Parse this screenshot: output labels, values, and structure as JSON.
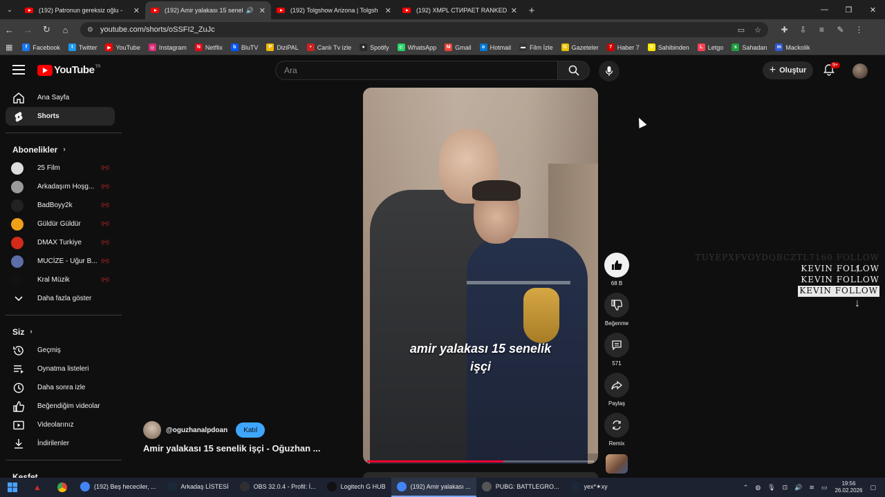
{
  "browser": {
    "tabs": [
      {
        "title": "(192) Patronun gereksiz oğlu -",
        "active": false
      },
      {
        "title": "(192) Amir yalakası 15 senel",
        "active": true,
        "audio": true
      },
      {
        "title": "(192) Tolgshow Arizona | Tolgsh",
        "active": false
      },
      {
        "title": "(192) XMPL СТИРАЕТ RANKED",
        "active": false
      }
    ],
    "url": "youtube.com/shorts/oSSFI2_ZuJc",
    "bookmarks": [
      {
        "label": "Facebook",
        "color": "#1877f2",
        "glyph": "f"
      },
      {
        "label": "Twitter",
        "color": "#1d9bf0",
        "glyph": "t"
      },
      {
        "label": "YouTube",
        "color": "#ff0000",
        "glyph": "▶"
      },
      {
        "label": "Instagram",
        "color": "#d62976",
        "glyph": "◎"
      },
      {
        "label": "Netflix",
        "color": "#e50914",
        "glyph": "N"
      },
      {
        "label": "BluTV",
        "color": "#0057ff",
        "glyph": "b"
      },
      {
        "label": "DiziPAL",
        "color": "#f2b705",
        "glyph": "P"
      },
      {
        "label": "Canlı Tv izle",
        "color": "#cc2222",
        "glyph": "•"
      },
      {
        "label": "Spotify",
        "color": "#2a2a2a",
        "glyph": "●"
      },
      {
        "label": "WhatsApp",
        "color": "#25d366",
        "glyph": "✆"
      },
      {
        "label": "Gmail",
        "color": "#ea4335",
        "glyph": "M"
      },
      {
        "label": "Hotmail",
        "color": "#0078d4",
        "glyph": "o"
      },
      {
        "label": "Film İzle",
        "color": "#333333",
        "glyph": "▬"
      },
      {
        "label": "Gazeteler",
        "color": "#e6c200",
        "glyph": "G"
      },
      {
        "label": "Haber 7",
        "color": "#d10000",
        "glyph": "7"
      },
      {
        "label": "Sahibinden",
        "color": "#ffe800",
        "glyph": "S"
      },
      {
        "label": "Letgo",
        "color": "#ff3f55",
        "glyph": "L"
      },
      {
        "label": "Sahadan",
        "color": "#1e9e3e",
        "glyph": "s"
      },
      {
        "label": "Mackolik",
        "color": "#2f5bd6",
        "glyph": "m"
      }
    ]
  },
  "youtube": {
    "logo_text": "YouTube",
    "region": "TR",
    "search_placeholder": "Ara",
    "create_label": "Oluştur",
    "notification_badge": "9+"
  },
  "sidebar": {
    "main": [
      {
        "label": "Ana Sayfa",
        "icon": "home-icon",
        "active": false
      },
      {
        "label": "Shorts",
        "icon": "shorts-icon",
        "active": true
      }
    ],
    "subscriptions_title": "Abonelikler",
    "subscriptions": [
      {
        "label": "25 Film",
        "color": "#dddddd"
      },
      {
        "label": "Arkadaşım Hoşg...",
        "color": "#9a9a9a"
      },
      {
        "label": "BadBoyy2k",
        "color": "#222222"
      },
      {
        "label": "Güldür Güldür",
        "color": "#f0a018"
      },
      {
        "label": "DMAX Turkiye",
        "color": "#d42a1c"
      },
      {
        "label": "MUCİZE - Uğur B...",
        "color": "#5b6ea8"
      },
      {
        "label": "Kral Müzik",
        "color": "#111111"
      }
    ],
    "show_more": "Daha fazla göster",
    "you_title": "Siz",
    "you_items": [
      {
        "label": "Geçmiş",
        "icon": "history-icon"
      },
      {
        "label": "Oynatma listeleri",
        "icon": "playlists-icon"
      },
      {
        "label": "Daha sonra izle",
        "icon": "watch-later-icon"
      },
      {
        "label": "Beğendiğim videolar",
        "icon": "liked-videos-icon"
      },
      {
        "label": "Videolarınız",
        "icon": "your-videos-icon"
      },
      {
        "label": "İndirilenler",
        "icon": "downloads-icon"
      }
    ],
    "explore_title": "Keşfet"
  },
  "short": {
    "caption_line1": "amir yalakası 15 senelik",
    "caption_line2": "işçi",
    "progress": 0.6,
    "channel": "@oguzhanalpdoan",
    "join_label": "Katıl",
    "title": "Amir yalakası 15 senelik işçi - Oğuzhan ...",
    "likes": "68 B",
    "dislike_label": "Beğenme",
    "comments": "571",
    "share_label": "Paylaş",
    "remix_label": "Remix"
  },
  "overlay": {
    "rows": [
      "TUYEPXFVOYDQBCZTL7160  FOLLOW",
      "KEVIN  FOLLOW",
      "KEVIN  FOLLOW",
      "KEVIN  FOLLOW"
    ]
  },
  "taskbar": {
    "items": [
      {
        "label": "(192) Beş hececiler, ...",
        "color": "#4285f4",
        "active": false
      },
      {
        "label": "Arkadaş LİSTESİ",
        "color": "#1b2838",
        "active": false
      },
      {
        "label": "OBS 32.0.4 - Profil: İ...",
        "color": "#302e31",
        "active": false
      },
      {
        "label": "Logitech G HUB",
        "color": "#111111",
        "active": false
      },
      {
        "label": "(192) Amir yalakası ...",
        "color": "#4285f4",
        "active": true
      },
      {
        "label": "PUBG: BATTLEGRO...",
        "color": "#555555",
        "active": false
      },
      {
        "label": "yex*✶xy",
        "color": "#1b2838",
        "active": false
      }
    ],
    "time": "19:56",
    "date": "26.02.2026"
  }
}
